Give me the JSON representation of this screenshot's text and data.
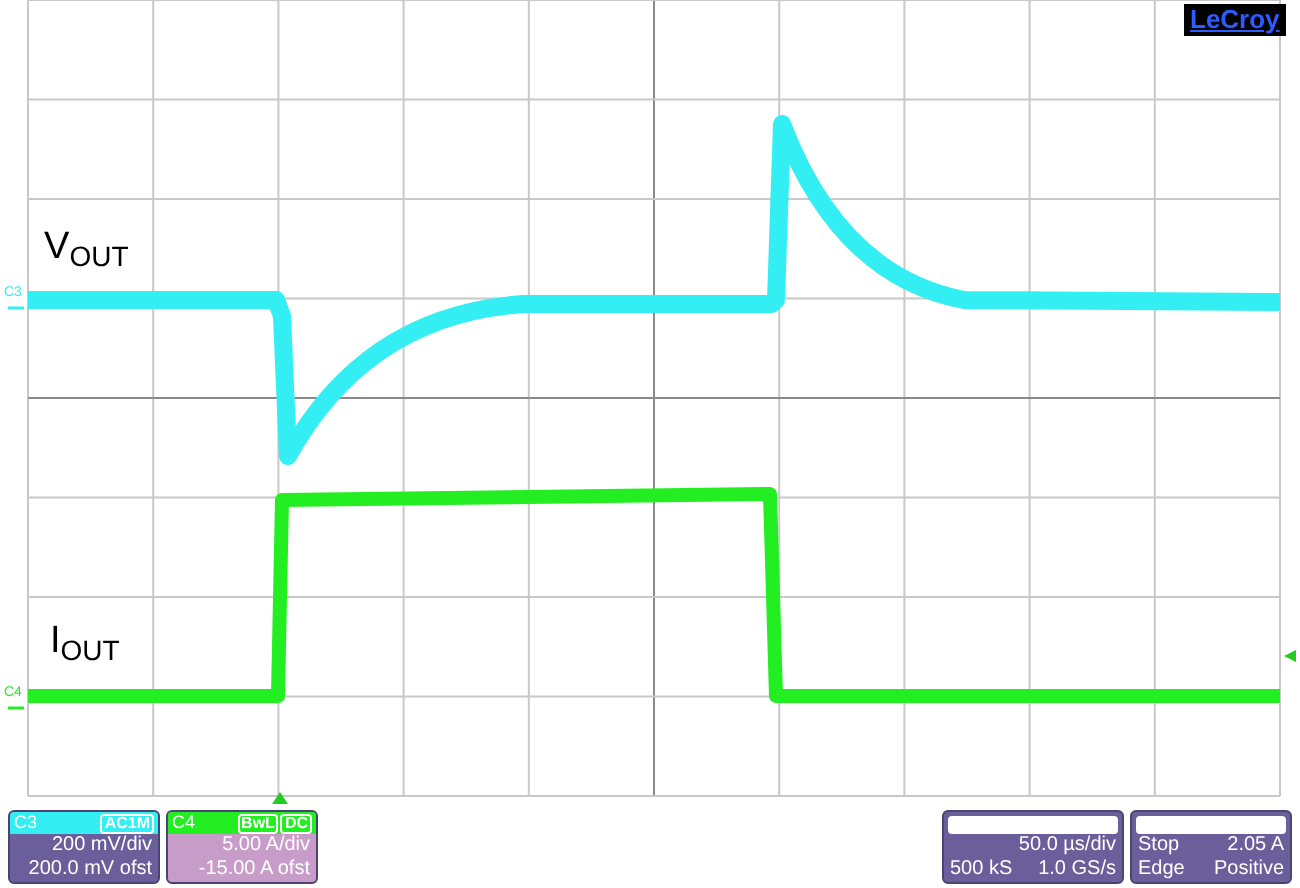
{
  "logo": {
    "text": "LeCroy"
  },
  "channels": [
    {
      "label": "C3",
      "marker_label": "C3",
      "kind": "voltage",
      "color": "#33eef2",
      "trace_label": "V$_{OUT}$",
      "badges": [
        "AC1M"
      ],
      "scale": "200 mV/div",
      "offset": "200.0 mV ofst"
    },
    {
      "label": "C4",
      "marker_label": "C4",
      "kind": "current",
      "color": "#22ee22",
      "trace_label": "I$_{OUT}$",
      "badges": [
        "BwL",
        "DC"
      ],
      "scale": "5.00 A/div",
      "offset": "-15.00 A ofst"
    }
  ],
  "timebase": {
    "scale": "50.0 µs/div",
    "samples": "500 kS",
    "rate": "1.0 GS/s"
  },
  "trigger": {
    "mode": "Stop",
    "threshold": "2.05 A",
    "type": "Edge",
    "slope": "Positive"
  }
}
